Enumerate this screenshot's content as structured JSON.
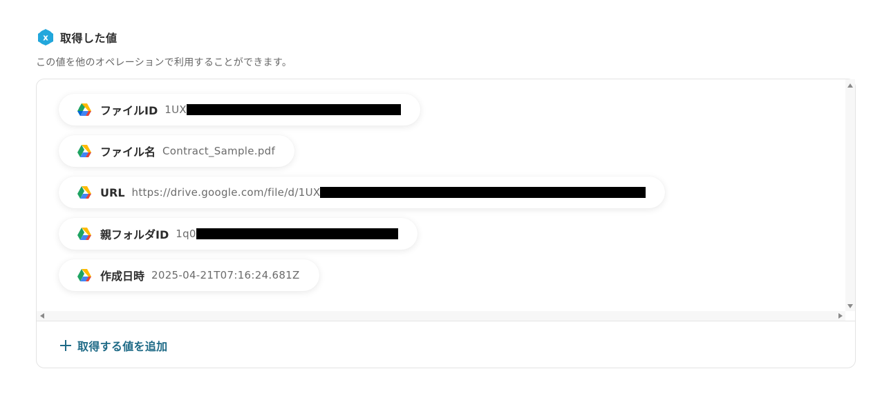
{
  "section": {
    "title": "取得した値",
    "description": "この値を他のオペレーションで利用することができます。",
    "badge_icon": "yoom-x-badge-icon",
    "badge_color": "#1fa3d6"
  },
  "values": [
    {
      "label": "ファイルID",
      "value": "1UX",
      "redacted": true,
      "icon": "google-drive-icon"
    },
    {
      "label": "ファイル名",
      "value": "Contract_Sample.pdf",
      "redacted": false,
      "icon": "google-drive-icon"
    },
    {
      "label": "URL",
      "value": "https://drive.google.com/file/d/1UX",
      "redacted": true,
      "icon": "google-drive-icon"
    },
    {
      "label": "親フォルダID",
      "value": "1q0",
      "redacted": true,
      "icon": "google-drive-icon"
    },
    {
      "label": "作成日時",
      "value": "2025-04-21T07:16:24.681Z",
      "redacted": false,
      "icon": "google-drive-icon"
    }
  ],
  "add_button": {
    "label": "取得する値を追加",
    "icon": "plus-icon",
    "color": "#1e6a86"
  }
}
